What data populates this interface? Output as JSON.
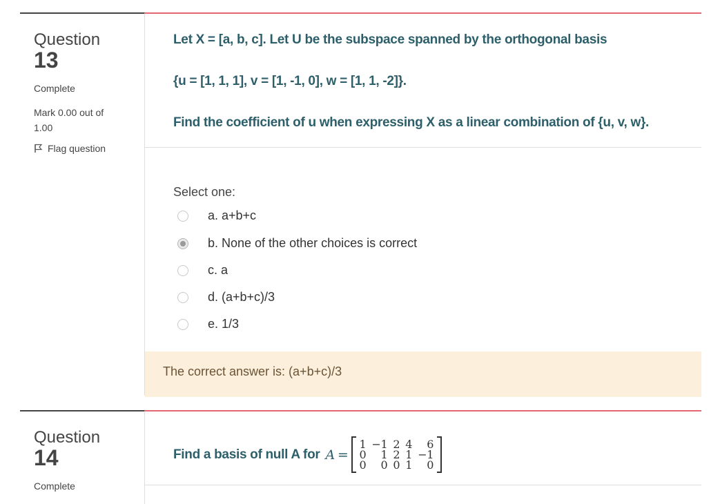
{
  "q13": {
    "label": "Question",
    "number": "13",
    "state": "Complete",
    "grade": "Mark 0.00 out of 1.00",
    "flag_label": "Flag question",
    "text_line1": "Let X = [a, b, c]. Let U be the subspace spanned by the orthogonal basis",
    "text_line2": "{u = [1, 1, 1], v = [1, -1, 0], w = [1, 1, -2]}.",
    "text_line3": "Find the coefficient of u when expressing X as a linear combination of {u, v, w}.",
    "prompt": "Select one:",
    "options": [
      {
        "label": "a. a+b+c",
        "selected": false
      },
      {
        "label": "b. None of the other choices is correct",
        "selected": true
      },
      {
        "label": "c. a",
        "selected": false
      },
      {
        "label": "d. (a+b+c)/3",
        "selected": false
      },
      {
        "label": "e. 1/3",
        "selected": false
      }
    ],
    "feedback": "The correct answer is: (a+b+c)/3"
  },
  "q14": {
    "label": "Question",
    "number": "14",
    "state": "Complete",
    "text": "Find a basis of null A for",
    "matrix_var": "A",
    "matrix_eq": "=",
    "matrix": [
      [
        "1",
        "−1",
        "2",
        "4",
        "6"
      ],
      [
        "0",
        "1",
        "2",
        "1",
        "−1"
      ],
      [
        "0",
        "0",
        "0",
        "1",
        "0"
      ]
    ]
  },
  "colors": {
    "question_text": "#2d5f6b",
    "accent_border": "#e56572",
    "feedback_bg": "#fcefdc"
  },
  "icons": {
    "flag": "flag-icon"
  }
}
